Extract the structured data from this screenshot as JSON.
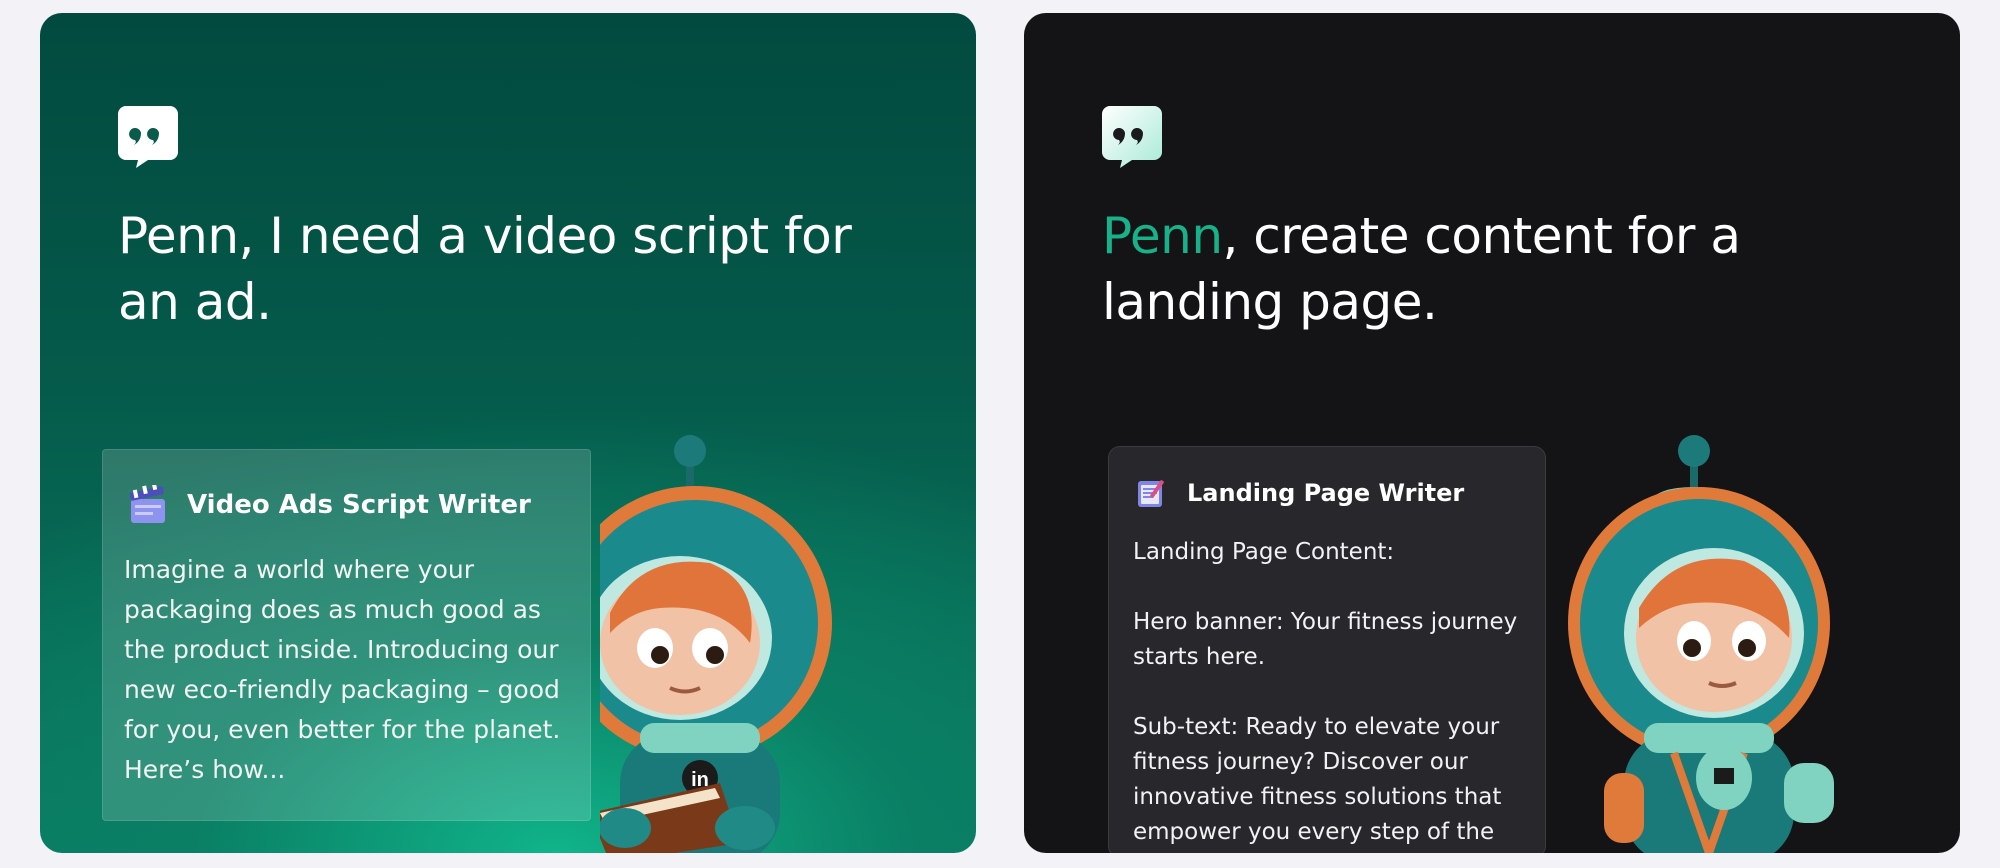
{
  "cards": [
    {
      "headline": "Penn, I need a video script for an ad.",
      "panel": {
        "title": "Video Ads Script Writer",
        "icon": "clapperboard-icon",
        "body": "Imagine a world where your packaging does as much good as the product inside. Introducing our new eco-friendly packaging – good for you, even better for the planet. Here’s how..."
      }
    },
    {
      "headline_accent": "Penn",
      "headline_rest": ", create content for a landing page.",
      "panel": {
        "title": "Landing Page Writer",
        "icon": "notepad-icon",
        "body": "Landing Page Content:\n\nHero banner: Your fitness journey starts here.\n\nSub-text: Ready to elevate your fitness journey? Discover our innovative fitness solutions that empower you every step of the"
      }
    }
  ],
  "colors": {
    "accent": "#17b289",
    "left_bg": "#0a7d62",
    "right_bg": "#141316"
  }
}
